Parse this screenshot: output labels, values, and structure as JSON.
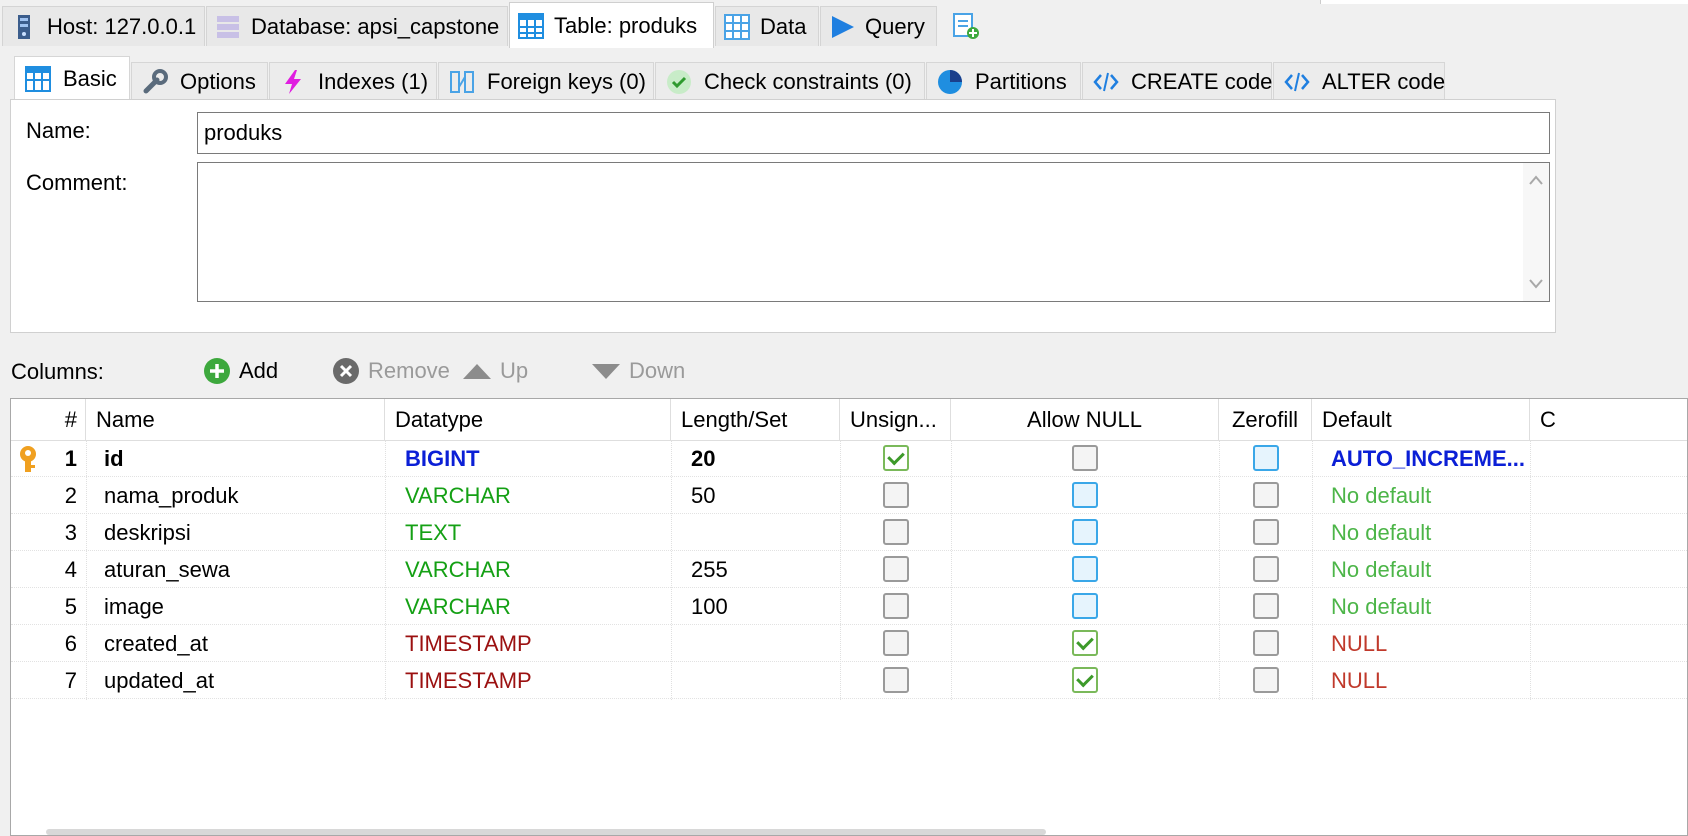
{
  "top_tabs": [
    {
      "label": "Host: 127.0.0.1",
      "icon": "server-icon"
    },
    {
      "label": "Database: apsi_capstone",
      "icon": "database-icon"
    },
    {
      "label": "Table: produks",
      "icon": "table-icon"
    },
    {
      "label": "Data",
      "icon": "data-grid-icon"
    },
    {
      "label": "Query",
      "icon": "play-icon"
    },
    {
      "label": "",
      "icon": "new-query-tab-icon"
    }
  ],
  "sub_tabs": [
    {
      "label": "Basic",
      "icon": "table-icon"
    },
    {
      "label": "Options",
      "icon": "wrench-icon"
    },
    {
      "label": "Indexes (1)",
      "icon": "lightning-icon"
    },
    {
      "label": "Foreign keys (0)",
      "icon": "foreign-key-icon"
    },
    {
      "label": "Check constraints (0)",
      "icon": "check-circle-icon"
    },
    {
      "label": "Partitions",
      "icon": "pie-icon"
    },
    {
      "label": "CREATE code",
      "icon": "code-icon"
    },
    {
      "label": "ALTER code",
      "icon": "code-icon"
    }
  ],
  "basic": {
    "name_label": "Name:",
    "name_value": "produks",
    "comment_label": "Comment:",
    "comment_value": ""
  },
  "columns_toolbar": {
    "label": "Columns:",
    "add": "Add",
    "remove": "Remove",
    "up": "Up",
    "down": "Down"
  },
  "grid": {
    "headers": [
      "#",
      "Name",
      "Datatype",
      "Length/Set",
      "Unsign...",
      "Allow NULL",
      "Zerofill",
      "Default",
      "C"
    ],
    "rows": [
      {
        "num": "1",
        "name": "id",
        "type": "BIGINT",
        "length": "20",
        "unsigned": true,
        "allow_null": false,
        "zerofill": false,
        "default": "AUTO_INCREME...",
        "primary_key": true
      },
      {
        "num": "2",
        "name": "nama_produk",
        "type": "VARCHAR",
        "length": "50",
        "unsigned": false,
        "allow_null": false,
        "zerofill": false,
        "default": "No default"
      },
      {
        "num": "3",
        "name": "deskripsi",
        "type": "TEXT",
        "length": "",
        "unsigned": false,
        "allow_null": false,
        "zerofill": false,
        "default": "No default"
      },
      {
        "num": "4",
        "name": "aturan_sewa",
        "type": "VARCHAR",
        "length": "255",
        "unsigned": false,
        "allow_null": false,
        "zerofill": false,
        "default": "No default"
      },
      {
        "num": "5",
        "name": "image",
        "type": "VARCHAR",
        "length": "100",
        "unsigned": false,
        "allow_null": false,
        "zerofill": false,
        "default": "No default"
      },
      {
        "num": "6",
        "name": "created_at",
        "type": "TIMESTAMP",
        "length": "",
        "unsigned": false,
        "allow_null": true,
        "zerofill": false,
        "default": "NULL"
      },
      {
        "num": "7",
        "name": "updated_at",
        "type": "TIMESTAMP",
        "length": "",
        "unsigned": false,
        "allow_null": true,
        "zerofill": false,
        "default": "NULL"
      }
    ]
  },
  "colors": {
    "int_type": "#0b1fd6",
    "string_type": "#14a014",
    "date_type": "#9b1010",
    "default_green": "#4cb548",
    "default_null": "#c0392b",
    "accent_blue": "#1f8ee0"
  }
}
